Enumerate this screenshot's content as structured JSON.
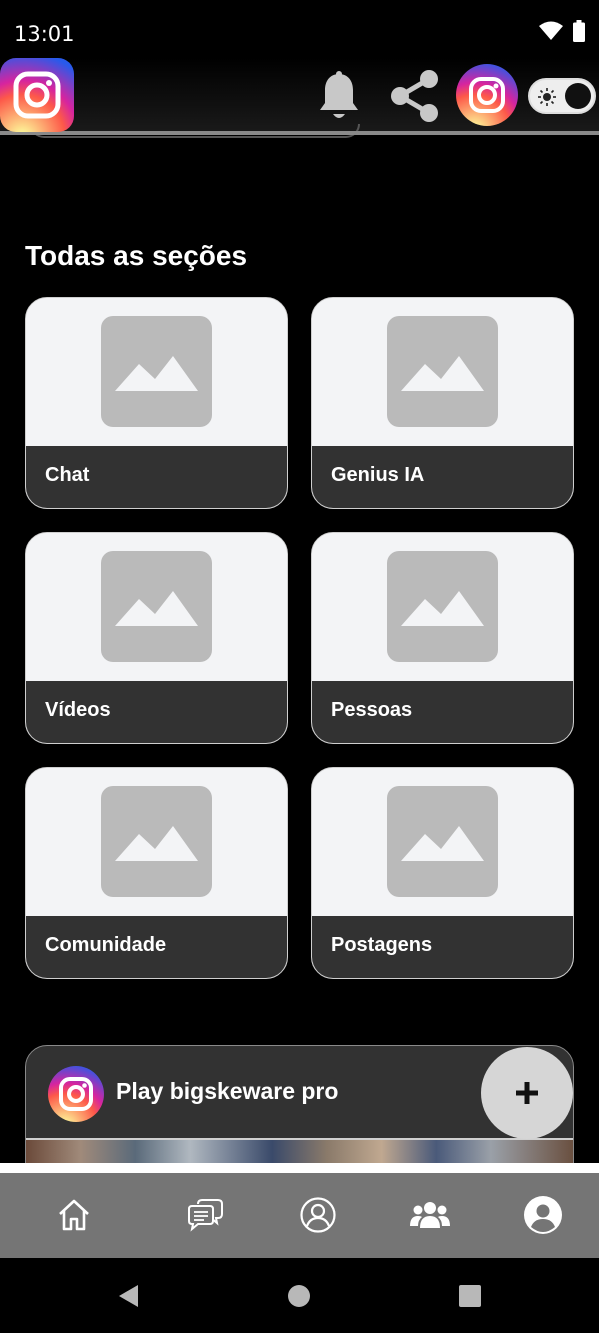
{
  "status_bar": {
    "time": "13:01"
  },
  "header": {
    "logo_icon": "instagram-icon",
    "actions": [
      "bell-icon",
      "share-icon",
      "instagram-icon",
      "theme-toggle"
    ]
  },
  "section": {
    "title": "Todas as seções"
  },
  "cards": [
    {
      "label": "Chat",
      "icon": "image-placeholder-icon"
    },
    {
      "label": "Genius IA",
      "icon": "image-placeholder-icon"
    },
    {
      "label": "Vídeos",
      "icon": "image-placeholder-icon"
    },
    {
      "label": "Pessoas",
      "icon": "image-placeholder-icon"
    },
    {
      "label": "Comunidade",
      "icon": "image-placeholder-icon"
    },
    {
      "label": "Postagens",
      "icon": "image-placeholder-icon"
    }
  ],
  "promo": {
    "title": "Play bigskeware pro",
    "fab_label": "+"
  },
  "bottom_nav": [
    "home-icon",
    "chat-bubbles-icon",
    "user-icon",
    "group-icon",
    "profile-icon"
  ],
  "system_nav": [
    "back-icon",
    "home-circle-icon",
    "recents-icon"
  ],
  "colors": {
    "card_footer": "#323232",
    "placeholder": "#bababa",
    "nav_bg": "#757575"
  }
}
